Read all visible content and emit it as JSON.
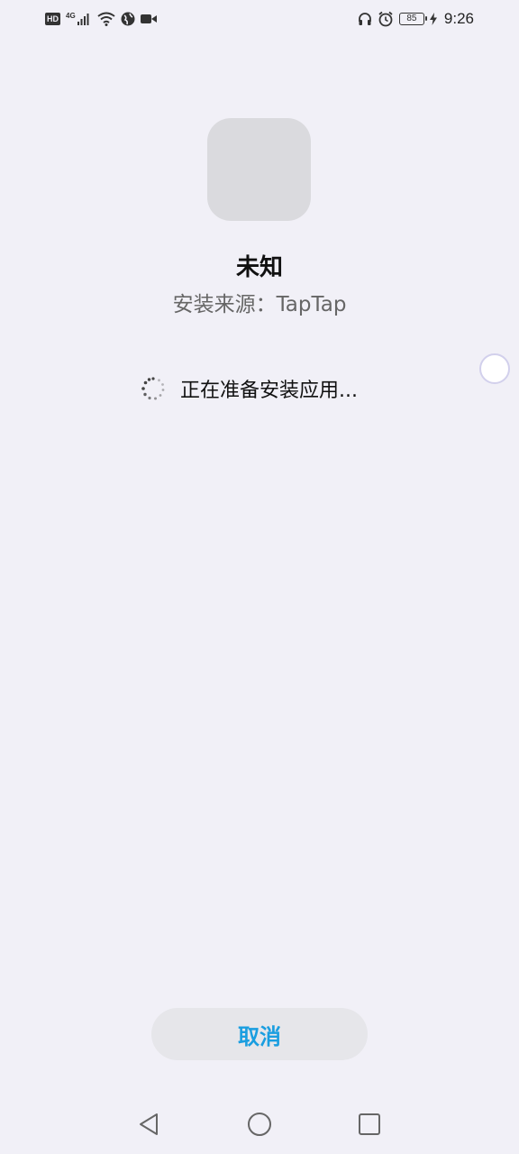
{
  "status_bar": {
    "hd": "HD",
    "network": "4G",
    "battery_level": "85",
    "time": "9:26",
    "icons": [
      "hd-icon",
      "signal-icon",
      "wifi-icon",
      "globe-icon",
      "video-icon",
      "headphone-icon",
      "alarm-icon",
      "battery-icon",
      "charging-icon"
    ]
  },
  "installer": {
    "app_name": "未知",
    "source": "安装来源：TapTap",
    "progress_text": "正在准备安装应用..."
  },
  "actions": {
    "cancel_label": "取消"
  },
  "colors": {
    "background": "#f1f0f7",
    "accent": "#1a9ee0",
    "button_bg": "#e6e6ea",
    "icon_placeholder": "#dadade"
  },
  "nav_bar": {
    "icons": [
      "back-icon",
      "home-icon",
      "recents-icon"
    ]
  }
}
